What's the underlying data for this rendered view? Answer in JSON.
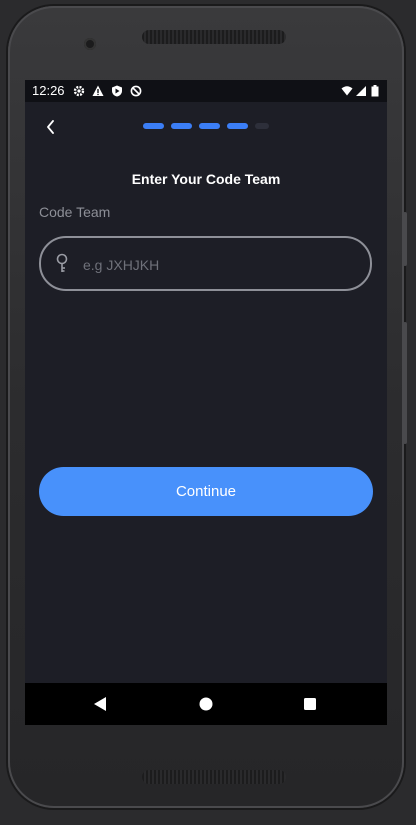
{
  "status_bar": {
    "time": "12:26",
    "left_icons": [
      "gear-icon",
      "warning-icon",
      "shield-icon",
      "no-sync-icon"
    ],
    "right_icons": [
      "wifi-icon",
      "signal-icon",
      "battery-icon"
    ]
  },
  "header": {
    "back_icon": "chevron-left-icon",
    "progress": {
      "total_steps": 5,
      "completed_steps": 4,
      "active_color": "#3b7ef6",
      "inactive_color": "#2d2f3a"
    }
  },
  "form": {
    "title": "Enter Your Code Team",
    "label": "Code Team",
    "input_value": "",
    "input_placeholder": "e.g JXHJKH",
    "input_icon": "key-icon"
  },
  "actions": {
    "continue_label": "Continue",
    "button_color": "#4891fb"
  },
  "nav_bar": {
    "back": "triangle-back-icon",
    "home": "circle-home-icon",
    "recents": "square-recents-icon"
  },
  "colors": {
    "background": "#1d1e26",
    "status_bar": "#0f1015",
    "nav_bar": "#000000"
  }
}
